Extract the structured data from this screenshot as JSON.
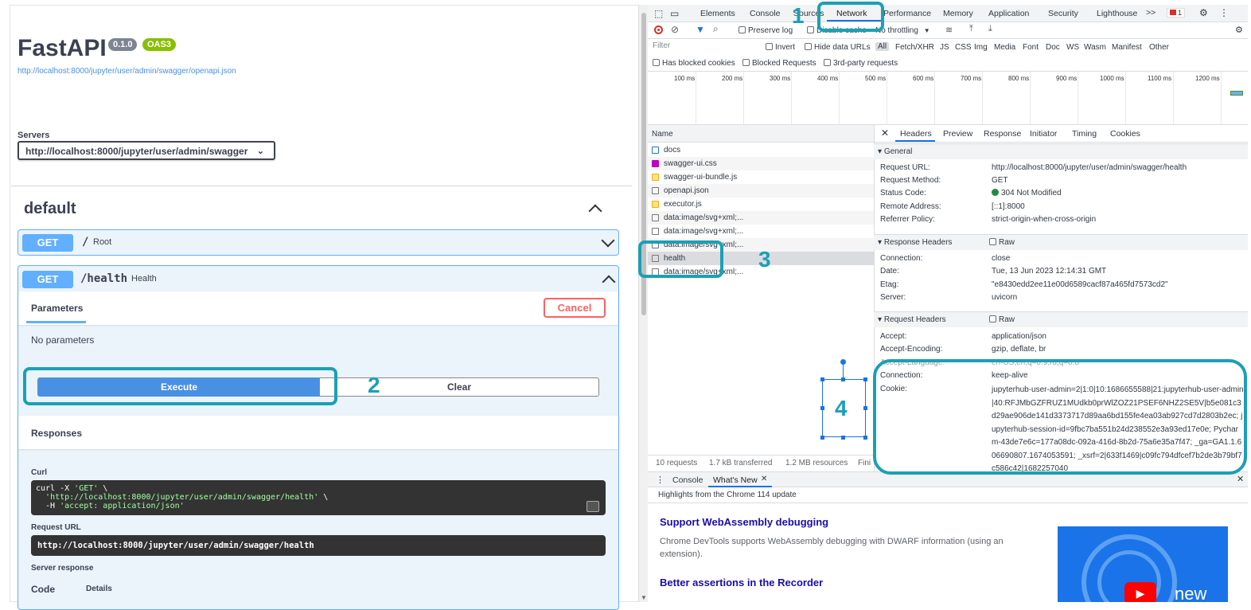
{
  "swagger": {
    "title": "FastAPI",
    "version_badge": "0.1.0",
    "oas_badge": "OAS3",
    "openapi_link": "http://localhost:8000/jupyter/user/admin/swagger/openapi.json",
    "servers_label": "Servers",
    "server_value": "http://localhost:8000/jupyter/user/admin/swagger",
    "section_title": "default",
    "endpoints": [
      {
        "method": "GET",
        "path": "/",
        "summary": "Root"
      },
      {
        "method": "GET",
        "path": "/health",
        "summary": "Health"
      }
    ],
    "parameters_title": "Parameters",
    "cancel_label": "Cancel",
    "no_params": "No parameters",
    "execute_label": "Execute",
    "clear_label": "Clear",
    "responses_title": "Responses",
    "curl_label": "Curl",
    "curl_line1_a": "curl -X ",
    "curl_line1_b": "'GET'",
    "curl_line1_c": " \\",
    "curl_line2_a": "  ",
    "curl_line2_b": "'http://localhost:8000/jupyter/user/admin/swagger/health'",
    "curl_line2_c": " \\",
    "curl_line3_a": "  -H ",
    "curl_line3_b": "'accept: application/json'",
    "request_url_label": "Request URL",
    "request_url": "http://localhost:8000/jupyter/user/admin/swagger/health",
    "server_response_label": "Server response",
    "code_header": "Code",
    "details_header": "Details"
  },
  "devtools": {
    "tabs": [
      "Elements",
      "Console",
      "Sources",
      "Network",
      "Performance",
      "Memory",
      "Application",
      "Security",
      "Lighthouse"
    ],
    "more_tabs": ">>",
    "error_count": "1",
    "preserve_log": "Preserve log",
    "disable_cache": "Disable cache",
    "throttling": "No throttling",
    "filter_placeholder": "Filter",
    "invert": "Invert",
    "hide_data_urls": "Hide data URLs",
    "type_filters": [
      "All",
      "Fetch/XHR",
      "JS",
      "CSS",
      "Img",
      "Media",
      "Font",
      "Doc",
      "WS",
      "Wasm",
      "Manifest",
      "Other"
    ],
    "has_blocked_cookies": "Has blocked cookies",
    "blocked_requests": "Blocked Requests",
    "third_party": "3rd-party requests",
    "timeline_ticks": [
      "100 ms",
      "200 ms",
      "300 ms",
      "400 ms",
      "500 ms",
      "600 ms",
      "700 ms",
      "800 ms",
      "900 ms",
      "1000 ms",
      "1100 ms",
      "1200 ms"
    ],
    "name_header": "Name",
    "requests": [
      "docs",
      "swagger-ui.css",
      "swagger-ui-bundle.js",
      "openapi.json",
      "executor.js",
      "data:image/svg+xml;...",
      "data:image/svg+xml;...",
      "data:image/svg+xml;...",
      "health",
      "data:image/svg+xml;..."
    ],
    "detail_tabs": [
      "Headers",
      "Preview",
      "Response",
      "Initiator",
      "Timing",
      "Cookies"
    ],
    "general_title": "General",
    "general": [
      {
        "k": "Request URL:",
        "v": "http://localhost:8000/jupyter/user/admin/swagger/health"
      },
      {
        "k": "Request Method:",
        "v": "GET"
      },
      {
        "k": "Status Code:",
        "v": "304 Not Modified"
      },
      {
        "k": "Remote Address:",
        "v": "[::1]:8000"
      },
      {
        "k": "Referrer Policy:",
        "v": "strict-origin-when-cross-origin"
      }
    ],
    "response_headers_title": "Response Headers",
    "raw_label": "Raw",
    "response_headers": [
      {
        "k": "Connection:",
        "v": "close"
      },
      {
        "k": "Date:",
        "v": "Tue, 13 Jun 2023 12:14:31 GMT"
      },
      {
        "k": "Etag:",
        "v": "\"e8430edd2ee11e00d6589cacf87a465fd7573cd2\""
      },
      {
        "k": "Server:",
        "v": "uvicorn"
      }
    ],
    "request_headers_title": "Request Headers",
    "request_headers": [
      {
        "k": "Accept:",
        "v": "application/json"
      },
      {
        "k": "Accept-Encoding:",
        "v": "gzip, deflate, br"
      },
      {
        "k": "Accept-Language:",
        "v": "en-US,en;q=0.9,ru;q=0.8"
      },
      {
        "k": "Connection:",
        "v": "keep-alive"
      },
      {
        "k": "Cookie:",
        "v": ""
      }
    ],
    "cookie_value": "jupyterhub-user-admin=2|1:0|10:1686655588|21:jupyterhub-user-admin|40:RFJMbGZFRUZ1MUdkb0prWlZOZ21PSEF6NHZ2SE5V|b5e081c3d29ae906de141d3373717d89aa6bd155fe4ea03ab927cd7d2803b2ec; jupyterhub-session-id=9fbc7ba551b24d238552e3a93ed17e0e; Pycharm-43de7e6c=177a08dc-092a-416d-8b2d-75a6e35a7f47; _ga=GA1.1.606690807.1674053591; _xsrf=2|633f1469|c09fc794dfcef7b2de3b79bf7c586c42|1682257040",
    "status_bar": [
      "10 requests",
      "1.7 kB transferred",
      "1.2 MB resources",
      "Fini"
    ],
    "drawer_tabs": [
      "Console",
      "What's New"
    ],
    "highlights": "Highlights from the Chrome 114 update",
    "news1_title": "Support WebAssembly debugging",
    "news1_body": "Chrome DevTools supports WebAssembly debugging with DWARF information (using an extension).",
    "news2_title": "Better assertions in the Recorder",
    "thumb_text": "new"
  },
  "annotations": [
    "1",
    "2",
    "3",
    "4"
  ],
  "colors": {
    "annotation": "#1ba0b5",
    "get": "#61affe",
    "execute": "#4990e2",
    "cancel": "#ff6060",
    "devtools_blue": "#1a73e8"
  }
}
